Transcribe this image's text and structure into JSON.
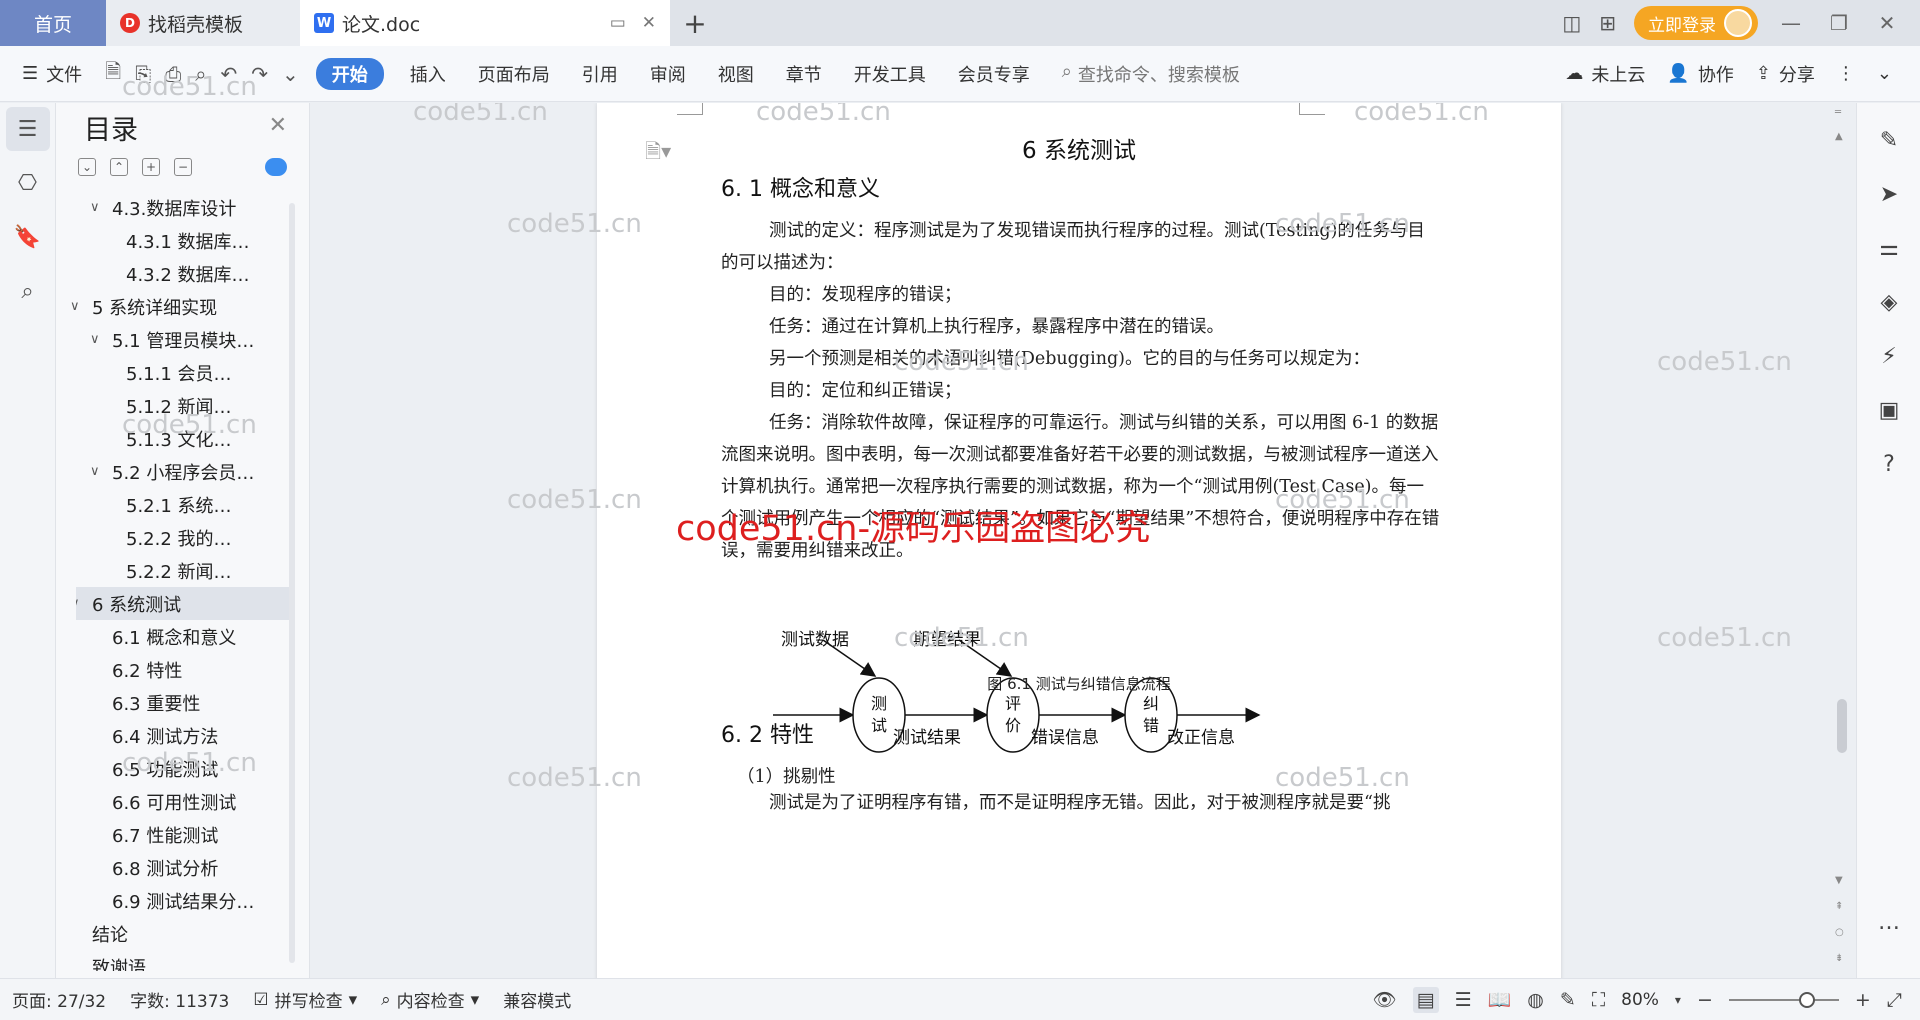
{
  "tabs": {
    "home": "首页",
    "template": "找稻壳模板",
    "document": "论文.doc"
  },
  "titlebar": {
    "login": "立即登录"
  },
  "ribbon": {
    "file": "文件",
    "start": "开始",
    "insert": "插入",
    "layout": "页面布局",
    "reference": "引用",
    "review": "审阅",
    "view": "视图",
    "chapter": "章节",
    "devtools": "开发工具",
    "member": "会员专享",
    "search_placeholder": "查找命令、搜索模板",
    "cloud": "未上云",
    "collab": "协作",
    "share": "分享"
  },
  "toc": {
    "title": "目录",
    "items": [
      {
        "label": "4.3.数据库设计",
        "level": 2,
        "chev": "v"
      },
      {
        "label": "4.3.1 数据库…",
        "level": 3,
        "chev": ""
      },
      {
        "label": "4.3.2 数据库…",
        "level": 3,
        "chev": ""
      },
      {
        "label": "5 系统详细实现",
        "level": 1,
        "chev": "v"
      },
      {
        "label": "5.1  管理员模块…",
        "level": 2,
        "chev": "v"
      },
      {
        "label": "5.1.1  会员…",
        "level": 3,
        "chev": ""
      },
      {
        "label": "5.1.2  新闻…",
        "level": 3,
        "chev": ""
      },
      {
        "label": "5.1.3  文化…",
        "level": 3,
        "chev": ""
      },
      {
        "label": "5.2  小程序会员…",
        "level": 2,
        "chev": "v"
      },
      {
        "label": "5.2.1  系统…",
        "level": 3,
        "chev": ""
      },
      {
        "label": "5.2.2  我的…",
        "level": 3,
        "chev": ""
      },
      {
        "label": "5.2.2  新闻…",
        "level": 3,
        "chev": ""
      },
      {
        "label": "6 系统测试",
        "level": 1,
        "chev": "v",
        "selected": true
      },
      {
        "label": "6.1 概念和意义",
        "level": 2,
        "chev": ""
      },
      {
        "label": "6.2 特性",
        "level": 2,
        "chev": ""
      },
      {
        "label": "6.3 重要性",
        "level": 2,
        "chev": ""
      },
      {
        "label": "6.4 测试方法",
        "level": 2,
        "chev": ""
      },
      {
        "label": "6.5 功能测试",
        "level": 2,
        "chev": ""
      },
      {
        "label": "6.6 可用性测试",
        "level": 2,
        "chev": ""
      },
      {
        "label": "6.7 性能测试",
        "level": 2,
        "chev": ""
      },
      {
        "label": "6.8 测试分析",
        "level": 2,
        "chev": ""
      },
      {
        "label": "6.9 测试结果分…",
        "level": 2,
        "chev": ""
      },
      {
        "label": "结论",
        "level": 1,
        "chev": ""
      },
      {
        "label": "致谢语",
        "level": 1,
        "chev": ""
      }
    ]
  },
  "document": {
    "chapter_title": "6 系统测试",
    "sec1_title": "6. 1 概念和意义",
    "sec1_lines": [
      "测试的定义：程序测试是为了发现错误而执行程序的过程。测试(Testing)的任务与目的可以描述为：",
      "目的：发现程序的错误；",
      "任务：通过在计算机上执行程序，暴露程序中潜在的错误。",
      "另一个预测是相关的术语叫纠错(Debugging)。它的目的与任务可以规定为：",
      "目的：定位和纠正错误；",
      "任务：消除软件故障，保证程序的可靠运行。测试与纠错的关系，可以用图 6-1 的数据流图来说明。图中表明，每一次测试都要准备好若干必要的测试数据，与被测试程序一道送入计算机执行。通常把一次程序执行需要的测试数据，称为一个“测试用例(Test Case)。每一个测试用例产生一个相应的“测试结果”。如果它与“期望结果”不想符合，便说明程序中存在错误，需要用纠错来改正。"
    ],
    "figure": {
      "input_data": "测试数据",
      "expected": "期望结果",
      "test_c1": "测",
      "test_c2": "试",
      "eval_c1": "评",
      "eval_c2": "价",
      "fix_c1": "纠",
      "fix_c2": "错",
      "test_result": "测试结果",
      "error_info": "错误信息",
      "fix_info": "改正信息"
    },
    "caption": "图 6.1 测试与纠错信息流程",
    "sec2_title": "6. 2 特性",
    "sec2_item": "（1）挑剔性",
    "sec2_partial": "测试是为了证明程序有错，而不是证明程序无错。因此，对于被测程序就是要“挑"
  },
  "watermarks": {
    "grey": "code51.cn",
    "red": "code51.cn-源码乐园盗图必究"
  },
  "status": {
    "page": "页面: 27/32",
    "words": "字数: 11373",
    "spell": "拼写检查",
    "content": "内容检查",
    "compat": "兼容模式",
    "zoom": "80%"
  },
  "colors": {
    "home_tab": "#6e87c4",
    "start_button": "#3b7ddd",
    "login_button": "#f5a623",
    "watermark_red": "#dd1f1f"
  }
}
